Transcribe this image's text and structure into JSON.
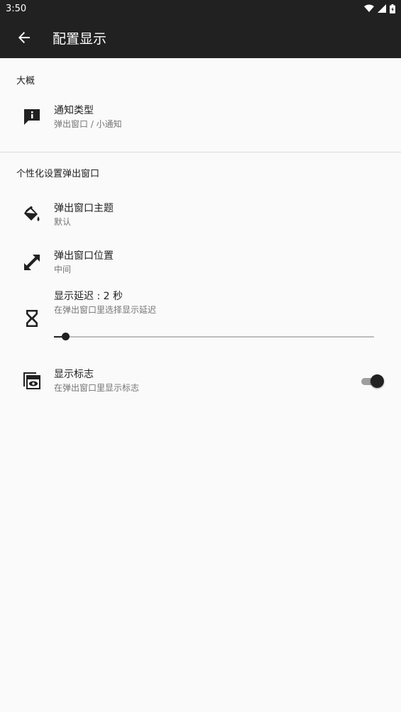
{
  "status_bar": {
    "time": "3:50"
  },
  "toolbar": {
    "title": "配置显示",
    "back_icon": "arrow-back-icon"
  },
  "sections": {
    "overview": {
      "header": "大概",
      "notification_type": {
        "title": "通知类型",
        "summary": "弹出窗口 / 小通知",
        "icon": "feedback-icon"
      }
    },
    "popup": {
      "header": "个性化设置弹出窗口",
      "theme": {
        "title": "弹出窗口主题",
        "summary": "默认",
        "icon": "paint-bucket-icon"
      },
      "position": {
        "title": "弹出窗口位置",
        "summary": "中间",
        "icon": "expand-arrows-icon"
      },
      "delay": {
        "title": "显示延迟 : 2 秒",
        "summary": "在弹出窗口里选择显示延迟",
        "icon": "hourglass-icon",
        "slider_fraction": 0.035
      },
      "show_logo": {
        "title": "显示标志",
        "summary": "在弹出窗口里显示标志",
        "icon": "logo-preview-icon",
        "enabled": true
      }
    }
  },
  "colors": {
    "toolbar": "#212121",
    "background": "#fafafa",
    "accent": "#212121"
  }
}
